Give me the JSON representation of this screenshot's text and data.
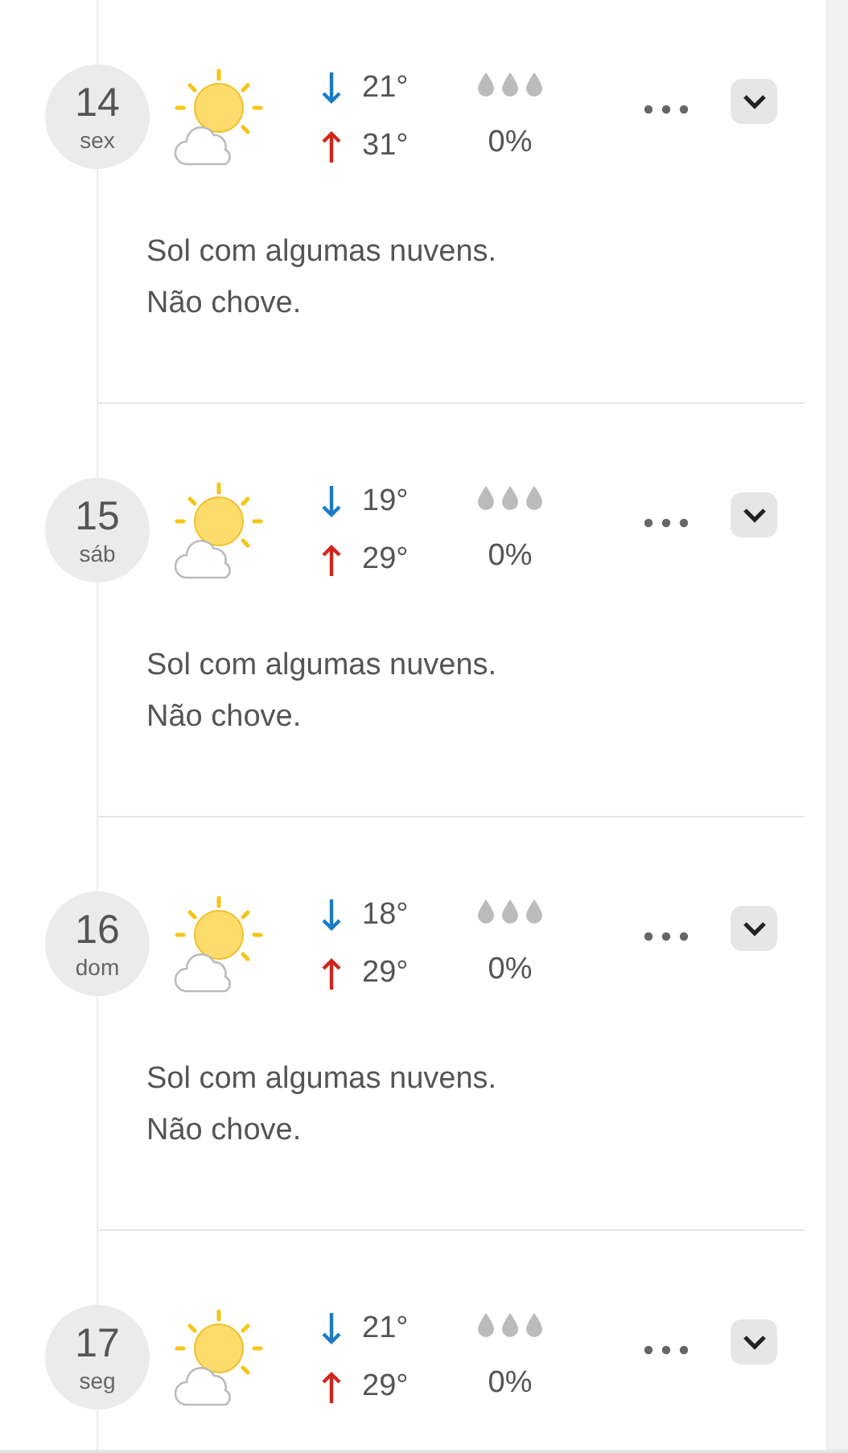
{
  "days": [
    {
      "day": "14",
      "weekday": "sex",
      "kind": "sun_cloud",
      "low": "21°",
      "high": "31°",
      "rain": "0%",
      "expanded": false,
      "description": [
        "Sol com algumas nuvens.",
        "Não chove."
      ]
    },
    {
      "day": "15",
      "weekday": "sáb",
      "kind": "sun_cloud",
      "low": "19°",
      "high": "29°",
      "rain": "0%",
      "expanded": false,
      "description": [
        "Sol com algumas nuvens.",
        "Não chove."
      ]
    },
    {
      "day": "16",
      "weekday": "dom",
      "kind": "sun_cloud",
      "low": "18°",
      "high": "29°",
      "rain": "0%",
      "expanded": false,
      "description": [
        "Sol com algumas nuvens.",
        "Não chove."
      ]
    },
    {
      "day": "17",
      "weekday": "seg",
      "kind": "sun_cloud",
      "low": "21°",
      "high": "29°",
      "rain": "0%",
      "expanded": false
    }
  ]
}
